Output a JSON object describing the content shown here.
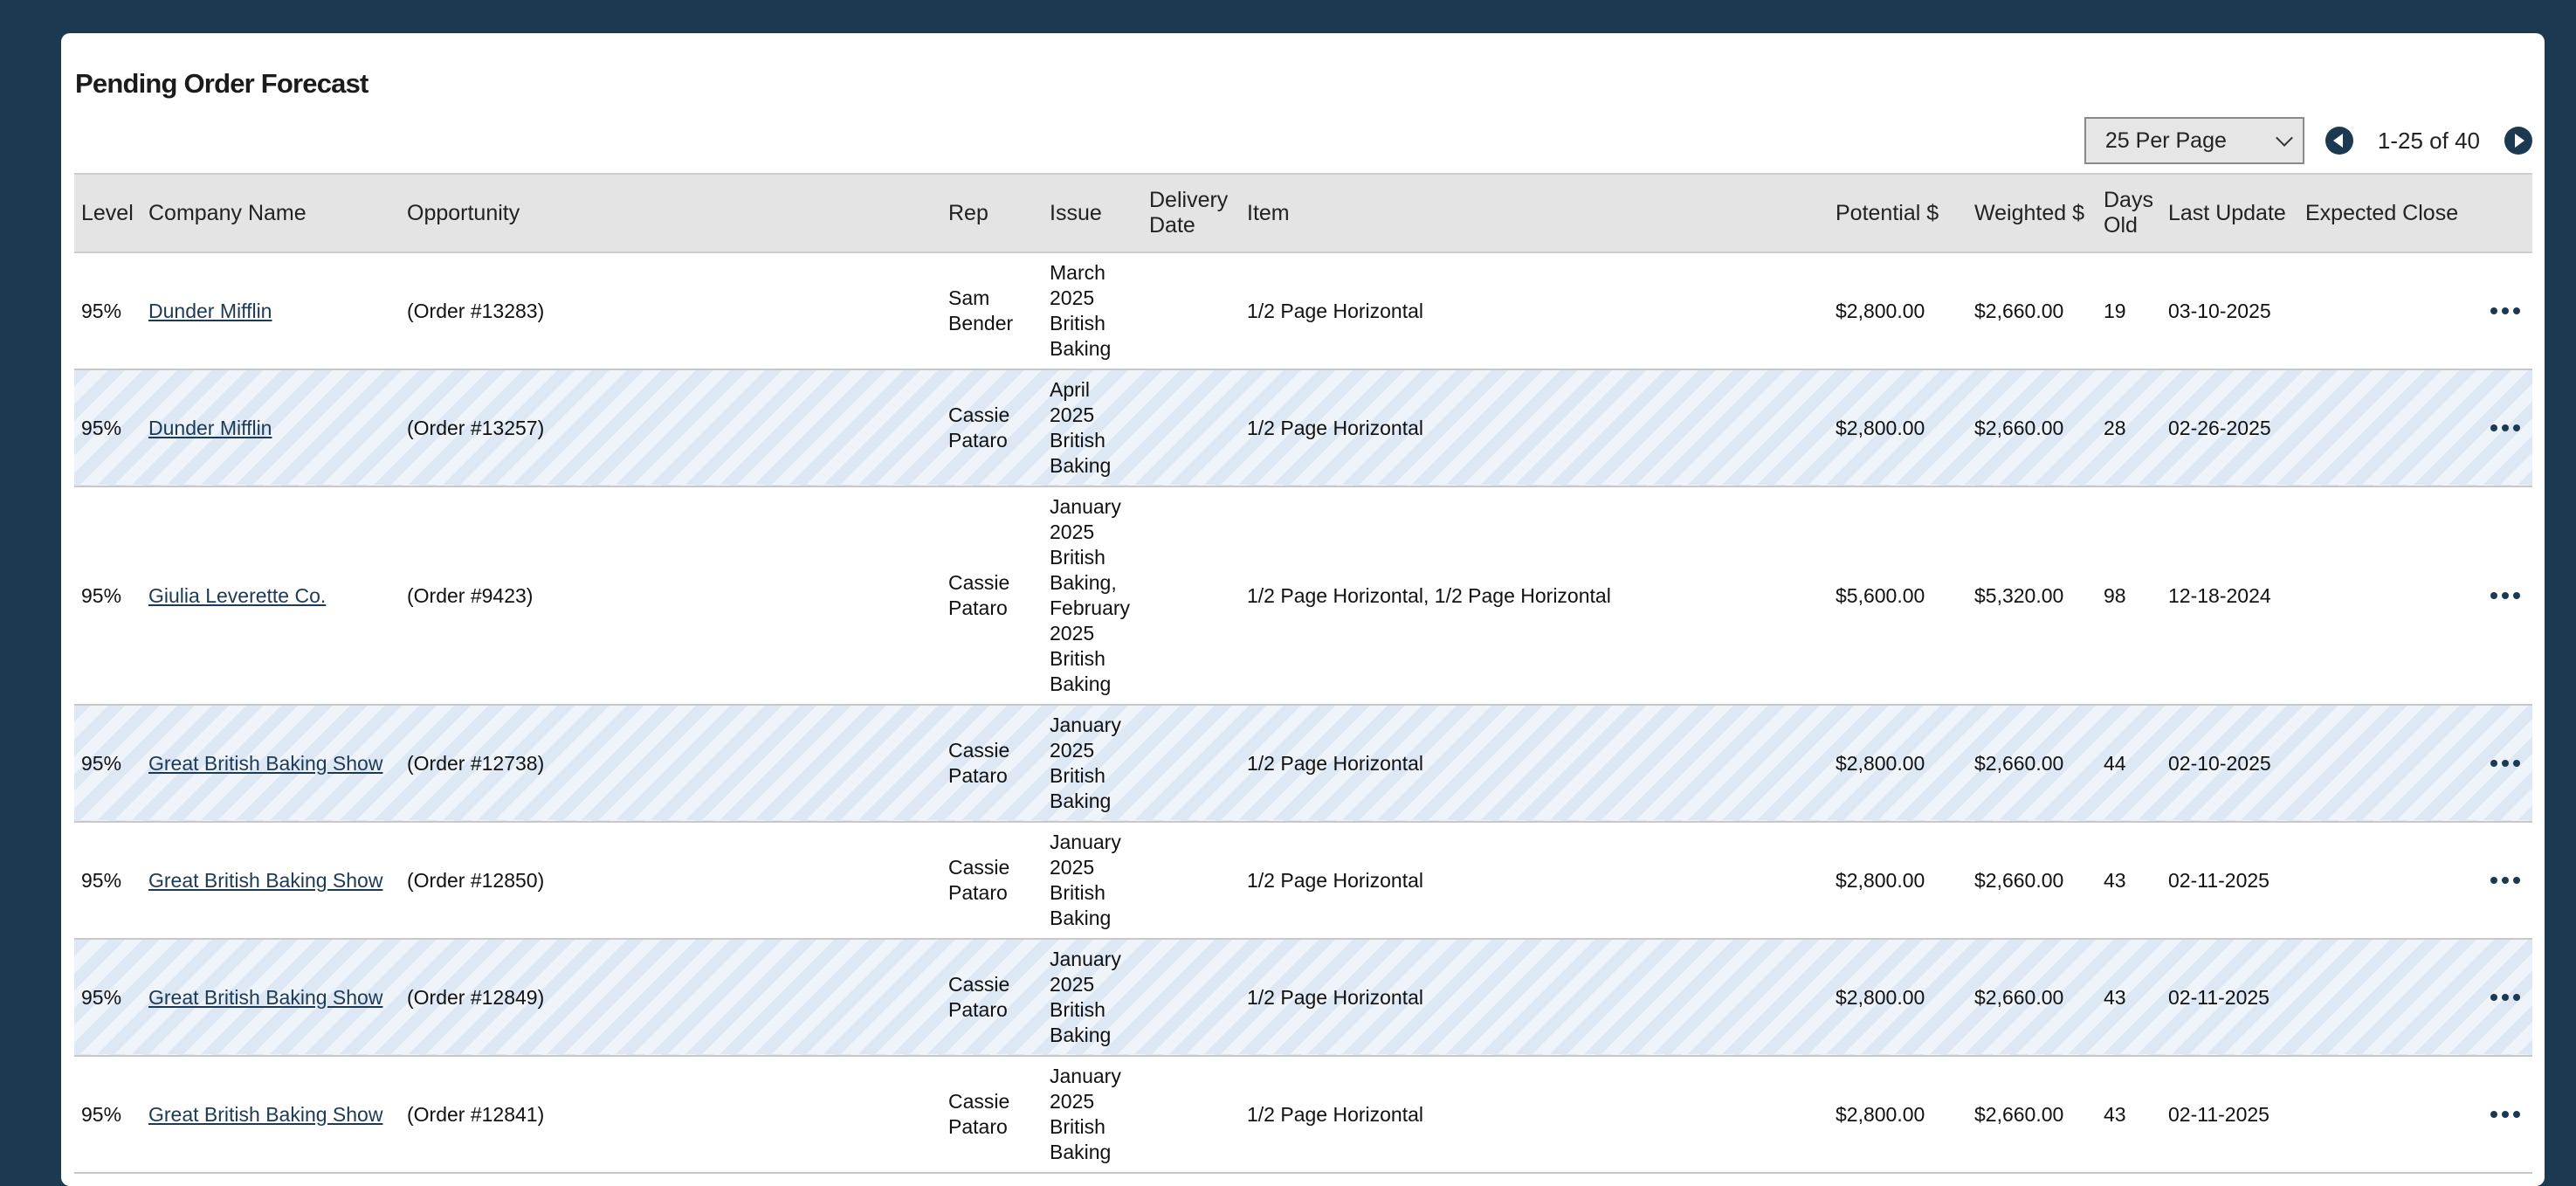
{
  "page": {
    "title": "Pending Order Forecast"
  },
  "pager": {
    "per_page": "25 Per Page",
    "range": "1-25 of 40"
  },
  "columns": [
    "Level",
    "Company Name",
    "Opportunity",
    "Rep",
    "Issue",
    "Delivery Date",
    "Item",
    "Potential $",
    "Weighted $",
    "Days Old",
    "Last Update",
    "Expected Close"
  ],
  "rows": [
    {
      "level": "95%",
      "company": "Dunder Mifflin",
      "opportunity": "(Order #13283)",
      "rep": "Sam Bender",
      "issue": [
        "March",
        "2025",
        "British",
        "Baking"
      ],
      "delivery": "",
      "item": "1/2 Page Horizontal",
      "potential": "$2,800.00",
      "weighted": "$2,660.00",
      "days": "19",
      "updated": "03-10-2025",
      "close": ""
    },
    {
      "level": "95%",
      "company": "Dunder Mifflin",
      "opportunity": "(Order #13257)",
      "rep": "Cassie Pataro",
      "issue": [
        "April",
        "2025",
        "British",
        "Baking"
      ],
      "delivery": "",
      "item": "1/2 Page Horizontal",
      "potential": "$2,800.00",
      "weighted": "$2,660.00",
      "days": "28",
      "updated": "02-26-2025",
      "close": ""
    },
    {
      "level": "95%",
      "company": "Giulia Leverette Co.",
      "opportunity": "(Order #9423)",
      "rep": "Cassie Pataro",
      "issue": [
        "January",
        "2025",
        "British",
        "Baking,",
        "February",
        "2025",
        "British",
        "Baking"
      ],
      "delivery": "",
      "item": "1/2 Page Horizontal, 1/2 Page Horizontal",
      "potential": "$5,600.00",
      "weighted": "$5,320.00",
      "days": "98",
      "updated": "12-18-2024",
      "close": ""
    },
    {
      "level": "95%",
      "company": "Great British Baking Show",
      "opportunity": "(Order #12738)",
      "rep": "Cassie Pataro",
      "issue": [
        "January",
        "2025",
        "British",
        "Baking"
      ],
      "delivery": "",
      "item": "1/2 Page Horizontal",
      "potential": "$2,800.00",
      "weighted": "$2,660.00",
      "days": "44",
      "updated": "02-10-2025",
      "close": ""
    },
    {
      "level": "95%",
      "company": "Great British Baking Show",
      "opportunity": "(Order #12850)",
      "rep": "Cassie Pataro",
      "issue": [
        "January",
        "2025",
        "British",
        "Baking"
      ],
      "delivery": "",
      "item": "1/2 Page Horizontal",
      "potential": "$2,800.00",
      "weighted": "$2,660.00",
      "days": "43",
      "updated": "02-11-2025",
      "close": ""
    },
    {
      "level": "95%",
      "company": "Great British Baking Show",
      "opportunity": "(Order #12849)",
      "rep": "Cassie Pataro",
      "issue": [
        "January",
        "2025",
        "British",
        "Baking"
      ],
      "delivery": "",
      "item": "1/2 Page Horizontal",
      "potential": "$2,800.00",
      "weighted": "$2,660.00",
      "days": "43",
      "updated": "02-11-2025",
      "close": ""
    },
    {
      "level": "95%",
      "company": "Great British Baking Show",
      "opportunity": "(Order #12841)",
      "rep": "Cassie Pataro",
      "issue": [
        "January",
        "2025",
        "British",
        "Baking"
      ],
      "delivery": "",
      "item": "1/2 Page Horizontal",
      "potential": "$2,800.00",
      "weighted": "$2,660.00",
      "days": "43",
      "updated": "02-11-2025",
      "close": ""
    }
  ],
  "icons": {
    "row_menu": "more-horizontal-icon",
    "prev": "chevron-left-circle-icon",
    "next": "chevron-right-circle-icon",
    "dropdown": "chevron-down-icon"
  },
  "colors": {
    "nav": "#1b3a52",
    "header_bg": "#e4e4e4",
    "stripe_a": "#dde8f4",
    "stripe_b": "#eff4fa",
    "link": "#1d3a55"
  }
}
